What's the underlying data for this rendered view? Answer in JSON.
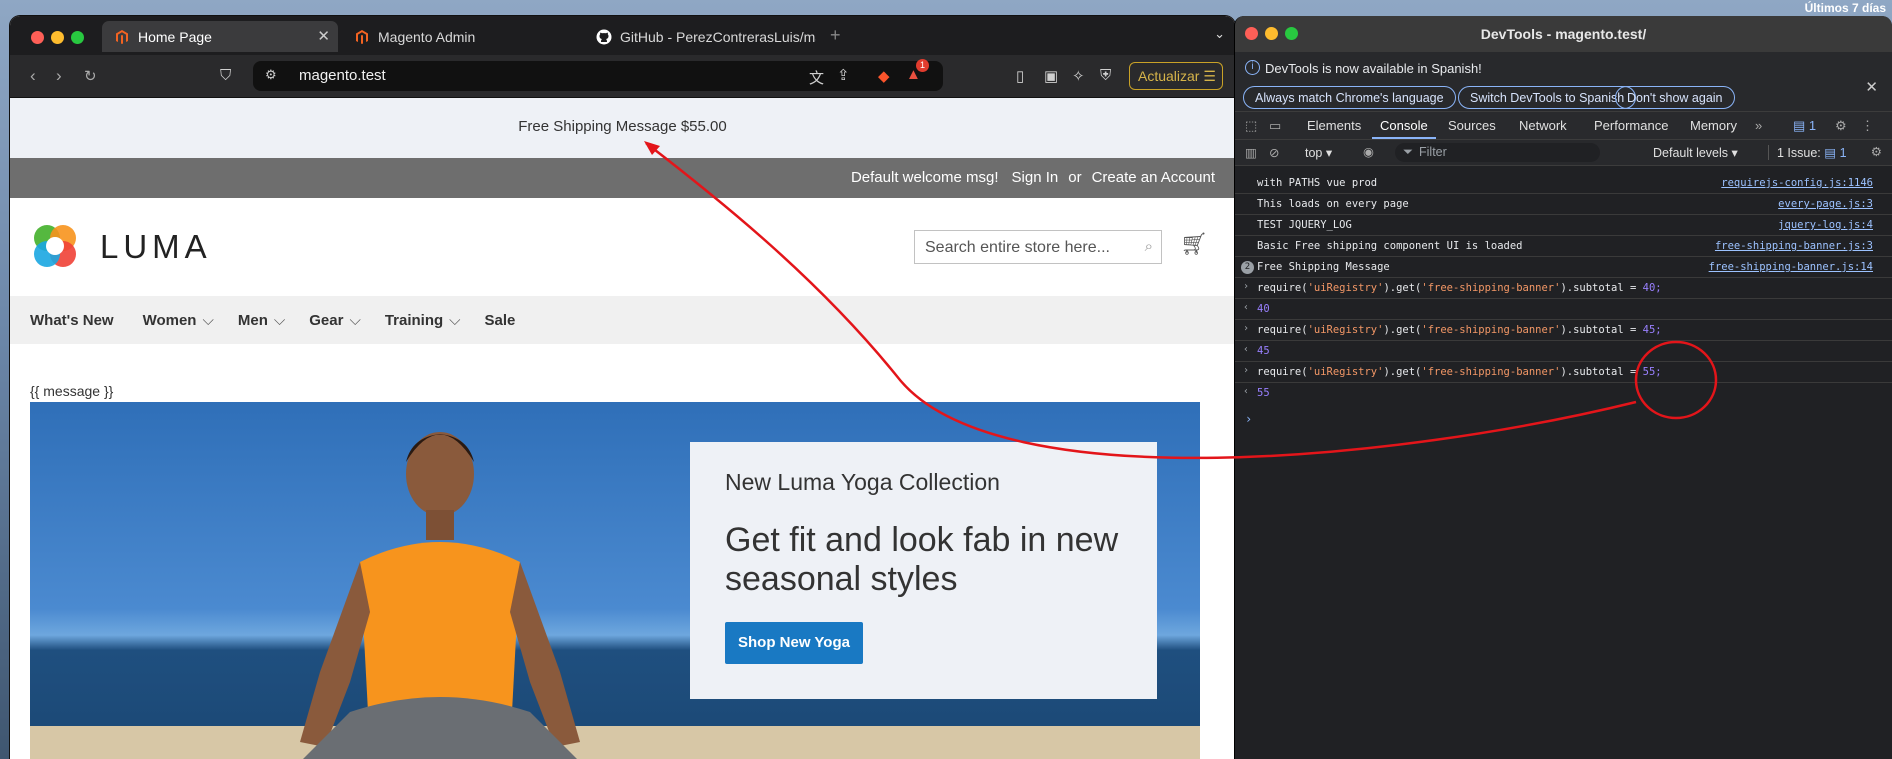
{
  "desktop": {
    "corner_label": "Últimos 7 días"
  },
  "browser": {
    "tabs": [
      {
        "label": "Home Page",
        "active": true
      },
      {
        "label": "Magento Admin",
        "active": false
      },
      {
        "label": "GitHub - PerezContrerasLuis/mag",
        "active": false
      }
    ],
    "url": "magento.test",
    "update_button": "Actualizar",
    "shield_badge": "1"
  },
  "site": {
    "banner_message": "Free Shipping Message $55.00",
    "welcome": "Default welcome msg!",
    "sign_in": "Sign In",
    "or": "or",
    "create_account": "Create an Account",
    "logo_text": "LUMA",
    "search_placeholder": "Search entire store here...",
    "nav": [
      {
        "label": "What's New",
        "has_menu": false
      },
      {
        "label": "Women",
        "has_menu": true
      },
      {
        "label": "Men",
        "has_menu": true
      },
      {
        "label": "Gear",
        "has_menu": true
      },
      {
        "label": "Training",
        "has_menu": true
      },
      {
        "label": "Sale",
        "has_menu": false
      }
    ],
    "message_template": "{{ message }}",
    "hero": {
      "subtitle": "New Luma Yoga Collection",
      "title": "Get fit and look fab in new seasonal styles",
      "button": "Shop New Yoga"
    }
  },
  "devtools": {
    "title": "DevTools - magento.test/",
    "info_message": "DevTools is now available in Spanish!",
    "info_buttons": [
      "Always match Chrome's language",
      "Switch DevTools to Spanish",
      "Don't show again"
    ],
    "tabs": [
      "Elements",
      "Console",
      "Sources",
      "Network",
      "Performance",
      "Memory"
    ],
    "active_tab": "Console",
    "issues_badge": "1",
    "context": "top",
    "filter_placeholder": "Filter",
    "levels": "Default levels",
    "issues_label": "1 Issue:",
    "issues_count": "1",
    "logs": [
      {
        "text": "with PATHS vue prod",
        "source": "requirejs-config.js:1146"
      },
      {
        "text": "This loads on every page",
        "source": "every-page.js:3"
      },
      {
        "text": "TEST JQUERY_LOG",
        "source": "jquery-log.js:4"
      },
      {
        "text": "Basic Free shipping component UI is loaded",
        "source": "free-shipping-banner.js:3"
      },
      {
        "text": "Free Shipping Message",
        "source": "free-shipping-banner.js:14",
        "count": "2"
      }
    ],
    "commands": [
      {
        "pre": "require(",
        "arg1": "'uiRegistry'",
        "mid": ").get(",
        "arg2": "'free-shipping-banner'",
        "post": ").subtotal = ",
        "value": "40;",
        "result": "40"
      },
      {
        "pre": "require(",
        "arg1": "'uiRegistry'",
        "mid": ").get(",
        "arg2": "'free-shipping-banner'",
        "post": ").subtotal = ",
        "value": "45;",
        "result": "45"
      },
      {
        "pre": "require(",
        "arg1": "'uiRegistry'",
        "mid": ").get(",
        "arg2": "'free-shipping-banner'",
        "post": ").subtotal = ",
        "value": "55;",
        "result": "55"
      }
    ]
  },
  "colors": {
    "annotation": "#e3151a",
    "accent_blue": "#1979c3",
    "devtools_link": "#9cc2ff"
  }
}
